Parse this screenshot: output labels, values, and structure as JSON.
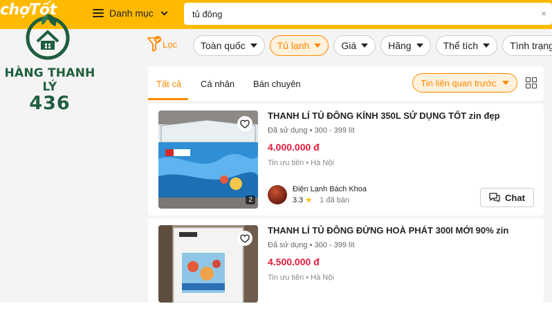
{
  "header": {
    "brand": "chợTốt",
    "menu_label": "Danh mục",
    "search_value": "tủ đông",
    "clear_label": "×"
  },
  "watermark": {
    "line1": "HÀNG THANH LÝ",
    "line2": "436",
    "color": "#1f5e3e"
  },
  "filters": {
    "filter_label": "Lọc",
    "chips": [
      {
        "label": "Toàn quốc",
        "active": false
      },
      {
        "label": "Tủ lạnh",
        "active": true
      },
      {
        "label": "Giá",
        "active": false
      },
      {
        "label": "Hãng",
        "active": false
      },
      {
        "label": "Thể tích",
        "active": false
      },
      {
        "label": "Tình trạng",
        "active": false
      }
    ]
  },
  "tabs": {
    "items": [
      "Tất cả",
      "Cá nhân",
      "Bán chuyên"
    ],
    "active_index": 0,
    "sort_label": "Tin liên quan trước"
  },
  "listings": [
    {
      "title": "THANH LÍ TỦ ĐÔNG KÍNH 350L SỬ DỤNG TỐT zin đẹp",
      "meta": "Đã sử dụng • 300 - 399 lít",
      "price": "4.000.000 đ",
      "location": "Tin ưu tiên • Hà Nội",
      "image_count": "2",
      "seller": {
        "name": "Điện Lạnh Bách Khoa",
        "rating": "3.3",
        "sold": "1 đã bán"
      },
      "chat_label": "Chat"
    },
    {
      "title": "THANH LÍ TỦ ĐÔNG ĐỨNG HOÀ PHÁT 300l MỚI 90% zin",
      "meta": "Đã sử dụng • 300 - 399 lít",
      "price": "4.500.000 đ",
      "location": "Tin ưu tiên • Hà Nội"
    }
  ],
  "colors": {
    "header": "#ffba00",
    "accent": "#ff8800",
    "price": "#e5193b"
  }
}
